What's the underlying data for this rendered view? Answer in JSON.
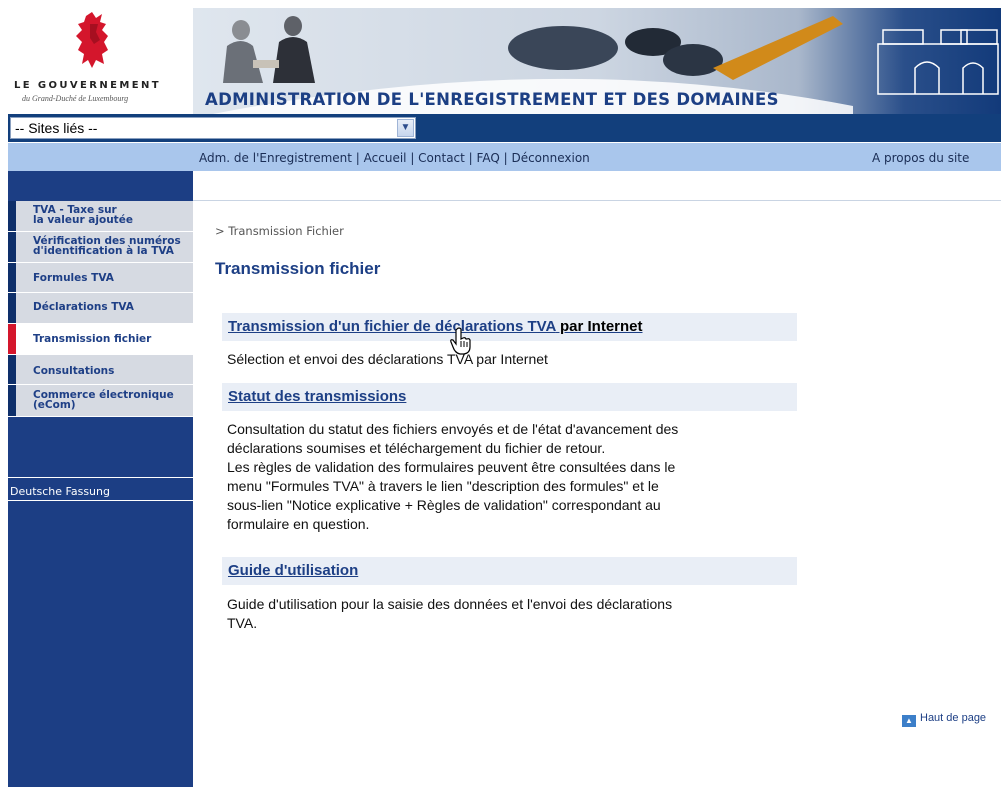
{
  "header": {
    "gov_title": "LE GOUVERNEMENT",
    "gov_subtitle": "du Grand-Duché de Luxembourg",
    "banner_title": "ADMINISTRATION DE L'ENREGISTREMENT ET DES DOMAINES",
    "colors": {
      "navy": "#123f7c",
      "light_blue": "#a9c6ec",
      "title_blue": "#1c3f84",
      "red": "#d4162c"
    }
  },
  "sites_select": {
    "value": "-- Sites liés --",
    "icon": "chevron-down-icon"
  },
  "nav": {
    "links": [
      "Adm. de l'Enregistrement",
      "Accueil",
      "Contact",
      "FAQ",
      "Déconnexion"
    ],
    "separator": " | ",
    "about": "A propos du site"
  },
  "sidebar": {
    "items": [
      {
        "label_line1": "TVA - Taxe sur",
        "label_line2": "la valeur ajoutée"
      },
      {
        "label_line1": "Vérification des numéros",
        "label_line2": "d'identification à la TVA"
      },
      {
        "label_line1": "Formules TVA",
        "label_line2": ""
      },
      {
        "label_line1": "Déclarations TVA",
        "label_line2": ""
      },
      {
        "label_line1": "Transmission fichier",
        "label_line2": "",
        "active": true
      },
      {
        "label_line1": "Consultations",
        "label_line2": ""
      },
      {
        "label_line1": "Commerce électronique",
        "label_line2": "(eCom)"
      }
    ],
    "deutsche": "Deutsche Fassung"
  },
  "content": {
    "breadcrumb": "> Transmission Fichier",
    "title": "Transmission fichier",
    "sections": [
      {
        "link": "Transmission d'un fichier de déclarations TVA",
        "extra": " par Internet",
        "desc": [
          "Sélection et envoi des déclarations TVA par Internet"
        ]
      },
      {
        "link": "Statut des transmissions",
        "extra": "",
        "desc": [
          "Consultation du statut des fichiers envoyés et de l'état d'avancement des",
          "déclarations soumises et téléchargement du fichier de retour.",
          "Les règles de validation des formulaires peuvent être consultées dans le",
          "menu \"Formules TVA\" à travers le lien \"description des formules\" et le",
          "sous-lien \"Notice explicative + Règles de validation\" correspondant au",
          "formulaire en question."
        ]
      },
      {
        "link": "Guide d'utilisation",
        "extra": "",
        "desc": [
          "Guide d'utilisation pour la saisie des données et l'envoi des déclarations",
          "TVA."
        ]
      }
    ],
    "top_link": "Haut de page",
    "top_icon": "arrow-up-icon"
  }
}
